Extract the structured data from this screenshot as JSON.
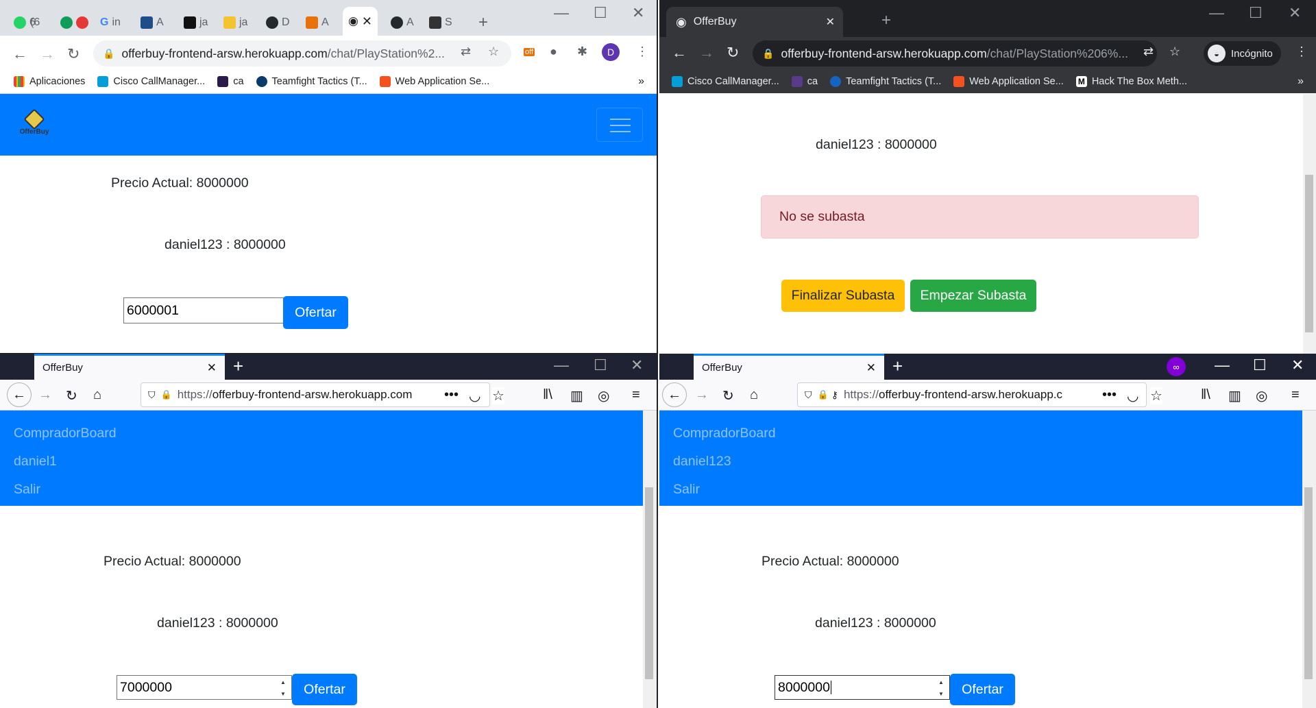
{
  "top_left": {
    "tabs": [
      "6",
      "(6",
      "in",
      "A",
      "ja",
      "ja",
      "D",
      "A",
      "A",
      "S"
    ],
    "omnibox": {
      "host": "offerbuy-frontend-arsw.herokuapp.com",
      "path": "/chat/PlayStation%2..."
    },
    "profile_initial": "D",
    "ext_badge": "off",
    "bookmarks": [
      "Aplicaciones",
      "Cisco CallManager...",
      "ca",
      "Teamfight Tactics (T...",
      "Web Application Se..."
    ],
    "bookmarks_more": "»",
    "logo_text": "OfferBuy",
    "precio_actual": "Precio Actual: 8000000",
    "last_bid": "daniel123 : 8000000",
    "bid_input_value": "6000001",
    "ofertar_label": "Ofertar"
  },
  "top_right": {
    "tab_title": "OfferBuy",
    "omnibox": {
      "host": "offerbuy-frontend-arsw.herokuapp.com",
      "path": "/chat/PlayStation%206%..."
    },
    "incognito_label": "Incógnito",
    "bookmarks": [
      "Cisco CallManager...",
      "ca",
      "Teamfight Tactics (T...",
      "Web Application Se...",
      "Hack The Box Meth..."
    ],
    "bookmarks_more": "»",
    "last_bid": "daniel123 : 8000000",
    "alert_text": "No se subasta",
    "finalizar_label": "Finalizar Subasta",
    "empezar_label": "Empezar Subasta"
  },
  "bottom_left": {
    "tab_title": "OfferBuy",
    "url": {
      "proto": "https://",
      "host": "offerbuy-frontend-arsw.herokuapp.com"
    },
    "menu": [
      "CompradorBoard",
      "daniel1",
      "Salir"
    ],
    "precio_actual": "Precio Actual: 8000000",
    "last_bid": "daniel123 : 8000000",
    "bid_input_value": "7000000",
    "ofertar_label": "Ofertar"
  },
  "bottom_right": {
    "tab_title": "OfferBuy",
    "url": {
      "proto": "https://",
      "host": "offerbuy-frontend-arsw.herokuapp.c"
    },
    "menu": [
      "CompradorBoard",
      "daniel123",
      "Salir"
    ],
    "precio_actual": "Precio Actual: 8000000",
    "last_bid": "daniel123 : 8000000",
    "bid_input_value": "8000000",
    "ofertar_label": "Ofertar"
  },
  "colors": {
    "primary": "#007bff",
    "warning": "#ffc107",
    "success": "#28a745",
    "alert_bg": "#f8d7da",
    "alert_text": "#721c24"
  }
}
